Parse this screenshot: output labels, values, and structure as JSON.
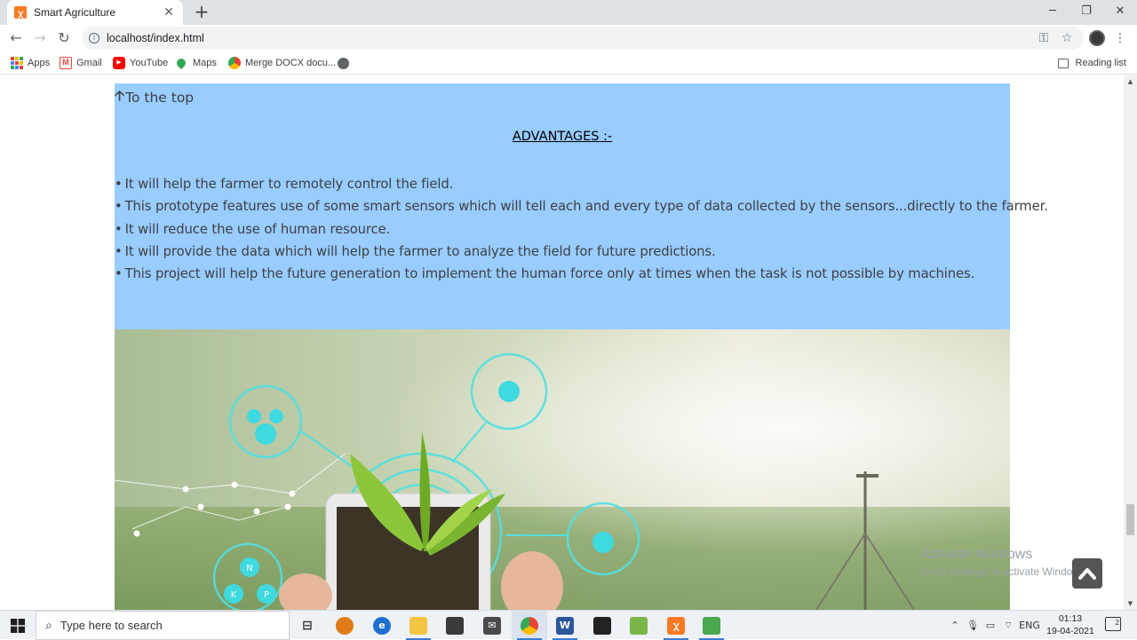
{
  "browser": {
    "tab_title": "Smart Agriculture",
    "tab_close": "✕",
    "new_tab": "+",
    "url": "localhost/index.html",
    "window_controls": {
      "minimize": "─",
      "maximize": "❐",
      "close": "✕"
    },
    "bookmarks": [
      "Apps",
      "Gmail",
      "YouTube",
      "Maps",
      "Merge DOCX docu..."
    ],
    "reading_list": "Reading list"
  },
  "page": {
    "to_top_arrow": "🡡",
    "to_top": "To the top",
    "advantages_heading": "ADVANTAGES :-",
    "bullet": "•",
    "advantages": [
      "It will help the farmer to remotely control the field.",
      "This prototype features use of some smart sensors which will tell each and every type of data collected by the sensors...directly to the farmer.",
      "It will reduce the use of human resource.",
      "It will provide the data which will help the farmer to analyze the field for future predictions.",
      "This project will help the future generation to implement the human force only at times when the task is not possible by machines."
    ],
    "hero_labels": [
      "N",
      "K",
      "P"
    ]
  },
  "watermark": {
    "line1": "Activate Windows",
    "line2": "Go to Settings to activate Windows."
  },
  "taskbar": {
    "search_placeholder": "Type here to search",
    "tray_lang": "ENG",
    "time": "01:13",
    "date": "19-04-2021",
    "notification_count": "2"
  },
  "colors": {
    "content_bg": "#99ccff",
    "scroll_btn": "#555555",
    "accent": "#3b7bd6"
  }
}
